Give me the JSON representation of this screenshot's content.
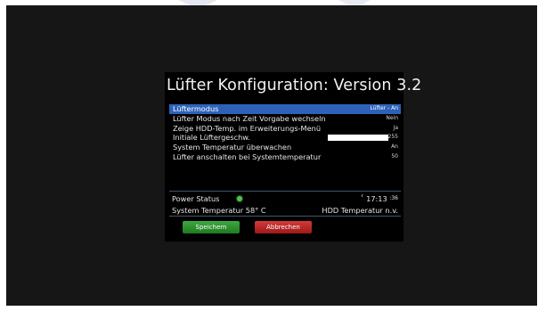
{
  "window": {
    "title": "Lüfter Konfiguration: Version 3.2"
  },
  "settings": [
    {
      "label": "Lüftermodus",
      "value": "Lüfter - An"
    },
    {
      "label": "Lüfter Modus nach Zeit Vorgabe wechseln",
      "value": "Nein"
    },
    {
      "label": "Zeige HDD-Temp. im Erweiterungs-Menü",
      "value": "Ja"
    },
    {
      "label": "Initiale Lüftergeschw.",
      "value": "255"
    },
    {
      "label": "System Temperatur überwachen",
      "value": "An"
    },
    {
      "label": "Lüfter anschalten bei Systemtemperatur",
      "value": "50"
    }
  ],
  "selected_index": 0,
  "status": {
    "power_label": "Power Status",
    "power_state": "on",
    "clock_flag": "⸢",
    "clock_time": "17:13",
    "clock_seconds": ":36",
    "system_temp": "System Temperatur 58° C",
    "hdd_temp": "HDD Temperatur n.v."
  },
  "buttons": {
    "save": "Speichern",
    "cancel": "Abbrechen"
  },
  "colors": {
    "selection": "#2d62b8",
    "save_button": "#2e8f31",
    "cancel_button": "#c02a2a",
    "power_indicator": "#4ec24a"
  }
}
